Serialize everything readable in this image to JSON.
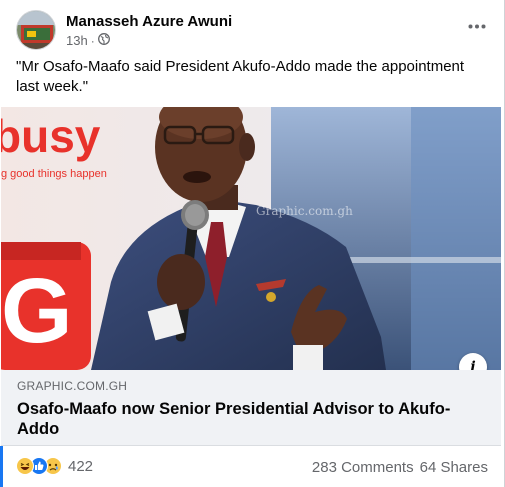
{
  "post": {
    "author": "Manasseh Azure Awuni",
    "time": "13h",
    "separator": "·",
    "privacy_icon": "globe-icon",
    "more_icon": "more-dots-icon",
    "text": "\"Mr Osafo-Maafo said President Akufo-Addo made the appointment last week.\""
  },
  "image": {
    "watermark": "Graphic.com.gh",
    "background_sign": "busy",
    "background_tagline": "g good things happen",
    "background_letter": "G"
  },
  "link": {
    "domain": "GRAPHIC.COM.GH",
    "title": "Osafo-Maafo now Senior Presidential Advisor to Akufo-Addo",
    "info_label": "i"
  },
  "footer": {
    "reaction_icons": [
      "haha-icon",
      "like-icon",
      "sad-icon"
    ],
    "reaction_count": "422",
    "comments": "283 Comments",
    "shares": "64 Shares"
  },
  "colors": {
    "accent": "#1877f2",
    "secondary_text": "#65676b",
    "link_bg": "#f0f2f5"
  }
}
